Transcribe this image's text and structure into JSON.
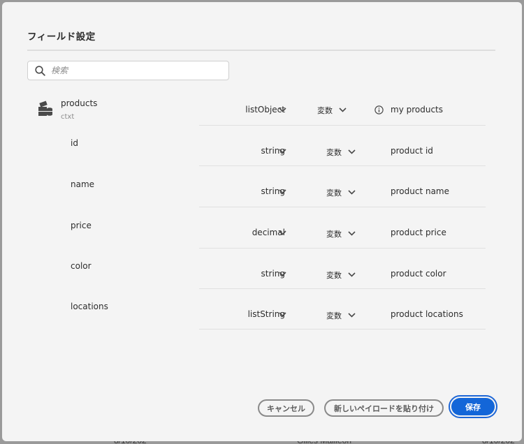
{
  "background": {
    "texts": [
      "8/10/202",
      "Gilles Mailleon",
      "8/10/202"
    ]
  },
  "dialog": {
    "title": "フィールド設定",
    "search": {
      "placeholder": "検索",
      "value": ""
    },
    "parent": {
      "name": "products",
      "context": "ctxt",
      "type": "listObject",
      "mode": "変数",
      "label": "my products",
      "icon": "object-stack-icon"
    },
    "fields": [
      {
        "name": "id",
        "type": "string",
        "mode": "変数",
        "label": "product id"
      },
      {
        "name": "name",
        "type": "string",
        "mode": "変数",
        "label": "product name"
      },
      {
        "name": "price",
        "type": "decimal",
        "mode": "変数",
        "label": "product price"
      },
      {
        "name": "color",
        "type": "string",
        "mode": "変数",
        "label": "product color"
      },
      {
        "name": "locations",
        "type": "listString",
        "mode": "変数",
        "label": "product locations"
      }
    ],
    "buttons": {
      "cancel": "キャンセル",
      "paste": "新しいペイロードを貼り付け",
      "save": "保存"
    }
  },
  "colors": {
    "primary": "#1366d8",
    "dialog_bg": "#f4f4f4",
    "text": "#2c2c2c"
  }
}
